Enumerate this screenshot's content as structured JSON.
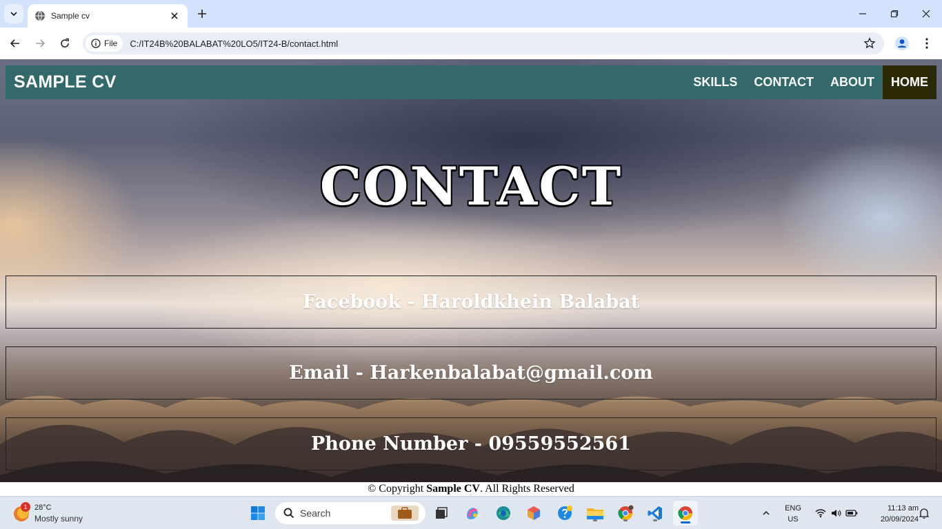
{
  "browser": {
    "tab_title": "Sample cv",
    "site_chip": "File",
    "url": "C:/IT24B%20BALABAT%20LO5/IT24-B/contact.html"
  },
  "site": {
    "brand": "SAMPLE CV",
    "nav": [
      "SKILLS",
      "CONTACT",
      "ABOUT",
      "HOME"
    ],
    "active_nav": "HOME",
    "nav_color": "#33696a",
    "active_nav_color": "#2c2a06",
    "heading": "CONTACT",
    "contacts": [
      "Facebook - Haroldkhein Balabat",
      "Email - Harkenbalabat@gmail.com",
      "Phone Number - 09559552561"
    ],
    "footer": {
      "prefix": "© Copyright ",
      "bold": "Sample CV",
      "suffix": ". All Rights Reserved"
    }
  },
  "taskbar": {
    "weather_badge": "1",
    "weather_temp": "28°C",
    "weather_desc": "Mostly sunny",
    "search_label": "Search",
    "lang_line1": "ENG",
    "lang_line2": "US",
    "time": "11:13 am",
    "date": "20/09/2024"
  }
}
